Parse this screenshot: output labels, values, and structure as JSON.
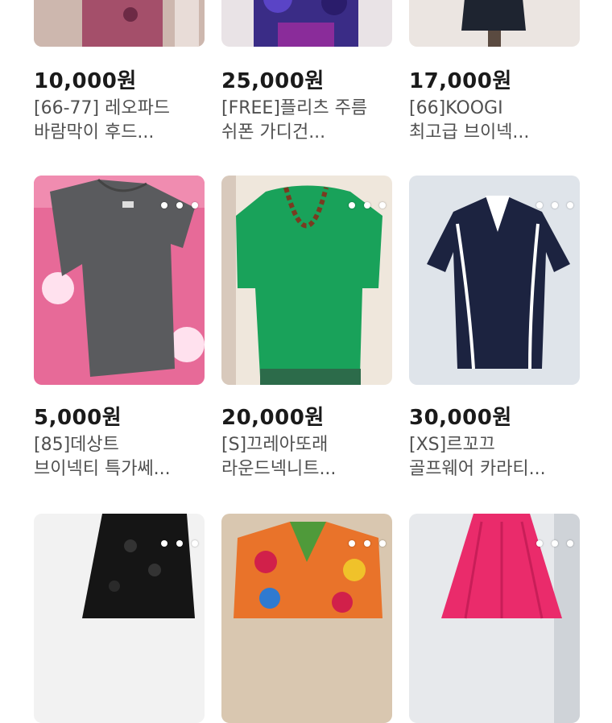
{
  "products": [
    {
      "price": "10,000원",
      "title_line1": "[66-77] 레오파드",
      "title_line2": "바람막이 후드...",
      "menu_icon": "more-horizontal-icon"
    },
    {
      "price": "25,000원",
      "title_line1": "[FREE]플리츠 주름",
      "title_line2": "쉬폰 가디건...",
      "menu_icon": "more-horizontal-icon"
    },
    {
      "price": "17,000원",
      "title_line1": "[66]KOOGI",
      "title_line2": "최고급 브이넥...",
      "menu_icon": "more-horizontal-icon"
    },
    {
      "price": "5,000원",
      "title_line1": "[85]데상트",
      "title_line2": "브이넥티 특가쎄...",
      "menu_icon": "more-horizontal-icon"
    },
    {
      "price": "20,000원",
      "title_line1": "[S]끄레아또래",
      "title_line2": "라운드넥니트...",
      "menu_icon": "more-horizontal-icon"
    },
    {
      "price": "30,000원",
      "title_line1": "[XS]르꼬끄",
      "title_line2": "골프웨어 카라티...",
      "menu_icon": "more-horizontal-icon"
    },
    {
      "menu_icon": "more-horizontal-icon"
    },
    {
      "menu_icon": "more-horizontal-icon"
    },
    {
      "menu_icon": "more-horizontal-icon"
    }
  ]
}
